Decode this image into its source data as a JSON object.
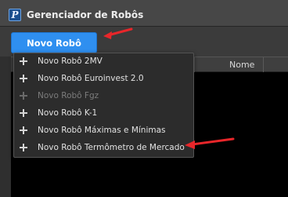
{
  "window": {
    "title": "Gerenciador de Robôs",
    "icon": "p-logo-icon"
  },
  "toolbar": {
    "new_robot_label": "Novo Robô"
  },
  "grid": {
    "columns": [
      "",
      "Nome"
    ]
  },
  "menu": {
    "items": [
      {
        "label": "Novo Robô 2MV",
        "enabled": true
      },
      {
        "label": "Novo Robô Euroinvest 2.0",
        "enabled": true
      },
      {
        "label": "Novo Robô Fgz",
        "enabled": false
      },
      {
        "label": "Novo Robô K-1",
        "enabled": true
      },
      {
        "label": "Novo Robô Máximas e Mínimas",
        "enabled": true
      },
      {
        "label": "Novo Robô Termômetro de Mercado",
        "enabled": true
      }
    ]
  },
  "colors": {
    "accent": "#2f8ff0",
    "annotation": "#e8262a"
  }
}
